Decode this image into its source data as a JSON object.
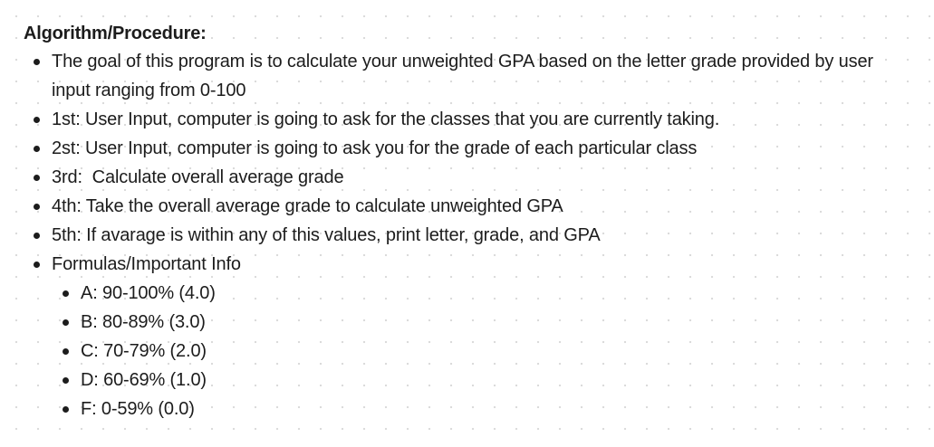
{
  "heading": "Algorithm/Procedure:",
  "steps": [
    "The goal of this program is to calculate your unweighted GPA based on the letter grade provided by user input ranging from 0-100",
    "1st: User Input, computer is going to ask for the classes that you are currently taking.",
    "2st: User Input, computer is going to ask you for the grade of each particular class",
    "3rd:  Calculate overall average grade",
    "4th: Take the overall average grade to calculate unweighted GPA",
    "5th: If avarage is within any of this values, print letter, grade, and GPA",
    "Formulas/Important Info"
  ],
  "grades": [
    "A: 90-100% (4.0)",
    "B: 80-89% (3.0)",
    "C: 70-79% (2.0)",
    "D: 60-69% (1.0)",
    "F: 0-59% (0.0)"
  ]
}
